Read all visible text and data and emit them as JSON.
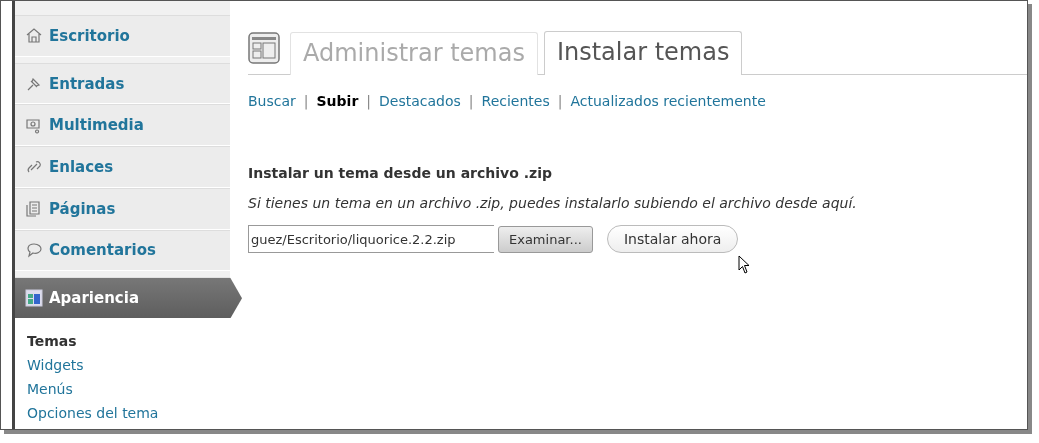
{
  "sidebar": {
    "items": [
      {
        "label": "Escritorio",
        "selected": false
      },
      {
        "label": "Entradas",
        "selected": false
      },
      {
        "label": "Multimedia",
        "selected": false
      },
      {
        "label": "Enlaces",
        "selected": false
      },
      {
        "label": "Páginas",
        "selected": false
      },
      {
        "label": "Comentarios",
        "selected": false
      },
      {
        "label": "Apariencia",
        "selected": true
      }
    ],
    "submenu": [
      {
        "label": "Temas",
        "selected": true
      },
      {
        "label": "Widgets",
        "selected": false
      },
      {
        "label": "Menús",
        "selected": false
      },
      {
        "label": "Opciones del tema",
        "selected": false
      }
    ]
  },
  "tabs": [
    {
      "label": "Administrar temas",
      "selected": false
    },
    {
      "label": "Instalar temas",
      "selected": true
    }
  ],
  "sublinks": [
    {
      "label": "Buscar",
      "selected": false
    },
    {
      "separator": "|",
      "label": "Subir",
      "selected": true
    },
    {
      "separator": "|",
      "label": "Destacados",
      "selected": false
    },
    {
      "separator": "|",
      "label": "Recientes",
      "selected": false
    },
    {
      "separator": "|",
      "label": "Actualizados recientemente",
      "selected": false
    }
  ],
  "upload": {
    "heading": "Instalar un tema desde un archivo .zip",
    "description": "Si tienes un tema en un archivo .zip, puedes instalarlo subiendo el archivo desde aquí.",
    "file_value": "guez/Escritorio/liquorice.2.2.zip",
    "browse_button": "Examinar...",
    "install_button": "Instalar ahora"
  }
}
